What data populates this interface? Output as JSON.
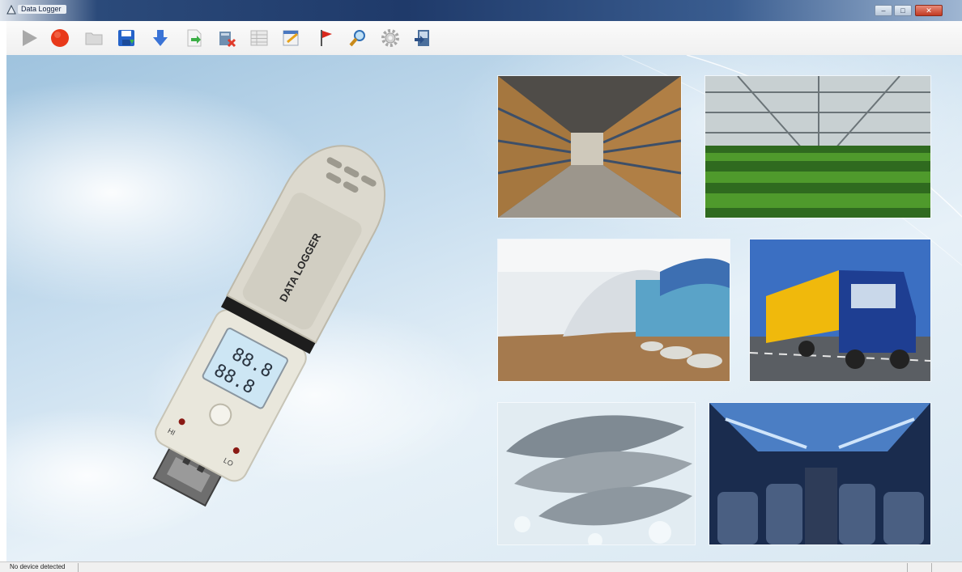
{
  "window": {
    "title": "Data Logger"
  },
  "toolbar": {
    "buttons": [
      {
        "name": "play-icon"
      },
      {
        "name": "stop-icon"
      },
      {
        "name": "open-folder-icon"
      },
      {
        "name": "save-icon"
      },
      {
        "name": "download-arrow-icon"
      },
      {
        "name": "export-icon"
      },
      {
        "name": "delete-data-icon"
      },
      {
        "name": "table-icon"
      },
      {
        "name": "chart-edit-icon"
      },
      {
        "name": "flag-icon"
      },
      {
        "name": "magnifier-icon"
      },
      {
        "name": "settings-gear-icon"
      },
      {
        "name": "exit-icon"
      }
    ]
  },
  "device": {
    "body_label": "DATA LOGGER",
    "display_top": "88.8",
    "display_bottom": "88.8",
    "led_hi": "HI",
    "led_lo": "LO"
  },
  "photos": [
    {
      "name": "warehouse-photo"
    },
    {
      "name": "greenhouse-photo"
    },
    {
      "name": "interior-photo"
    },
    {
      "name": "truck-photo"
    },
    {
      "name": "fish-photo"
    },
    {
      "name": "airplane-cabin-photo"
    }
  ],
  "status": {
    "text": "No device detected"
  },
  "colors": {
    "stop": "#e8391a",
    "save": "#2563c9",
    "titlebar": "#1f3a6a"
  }
}
